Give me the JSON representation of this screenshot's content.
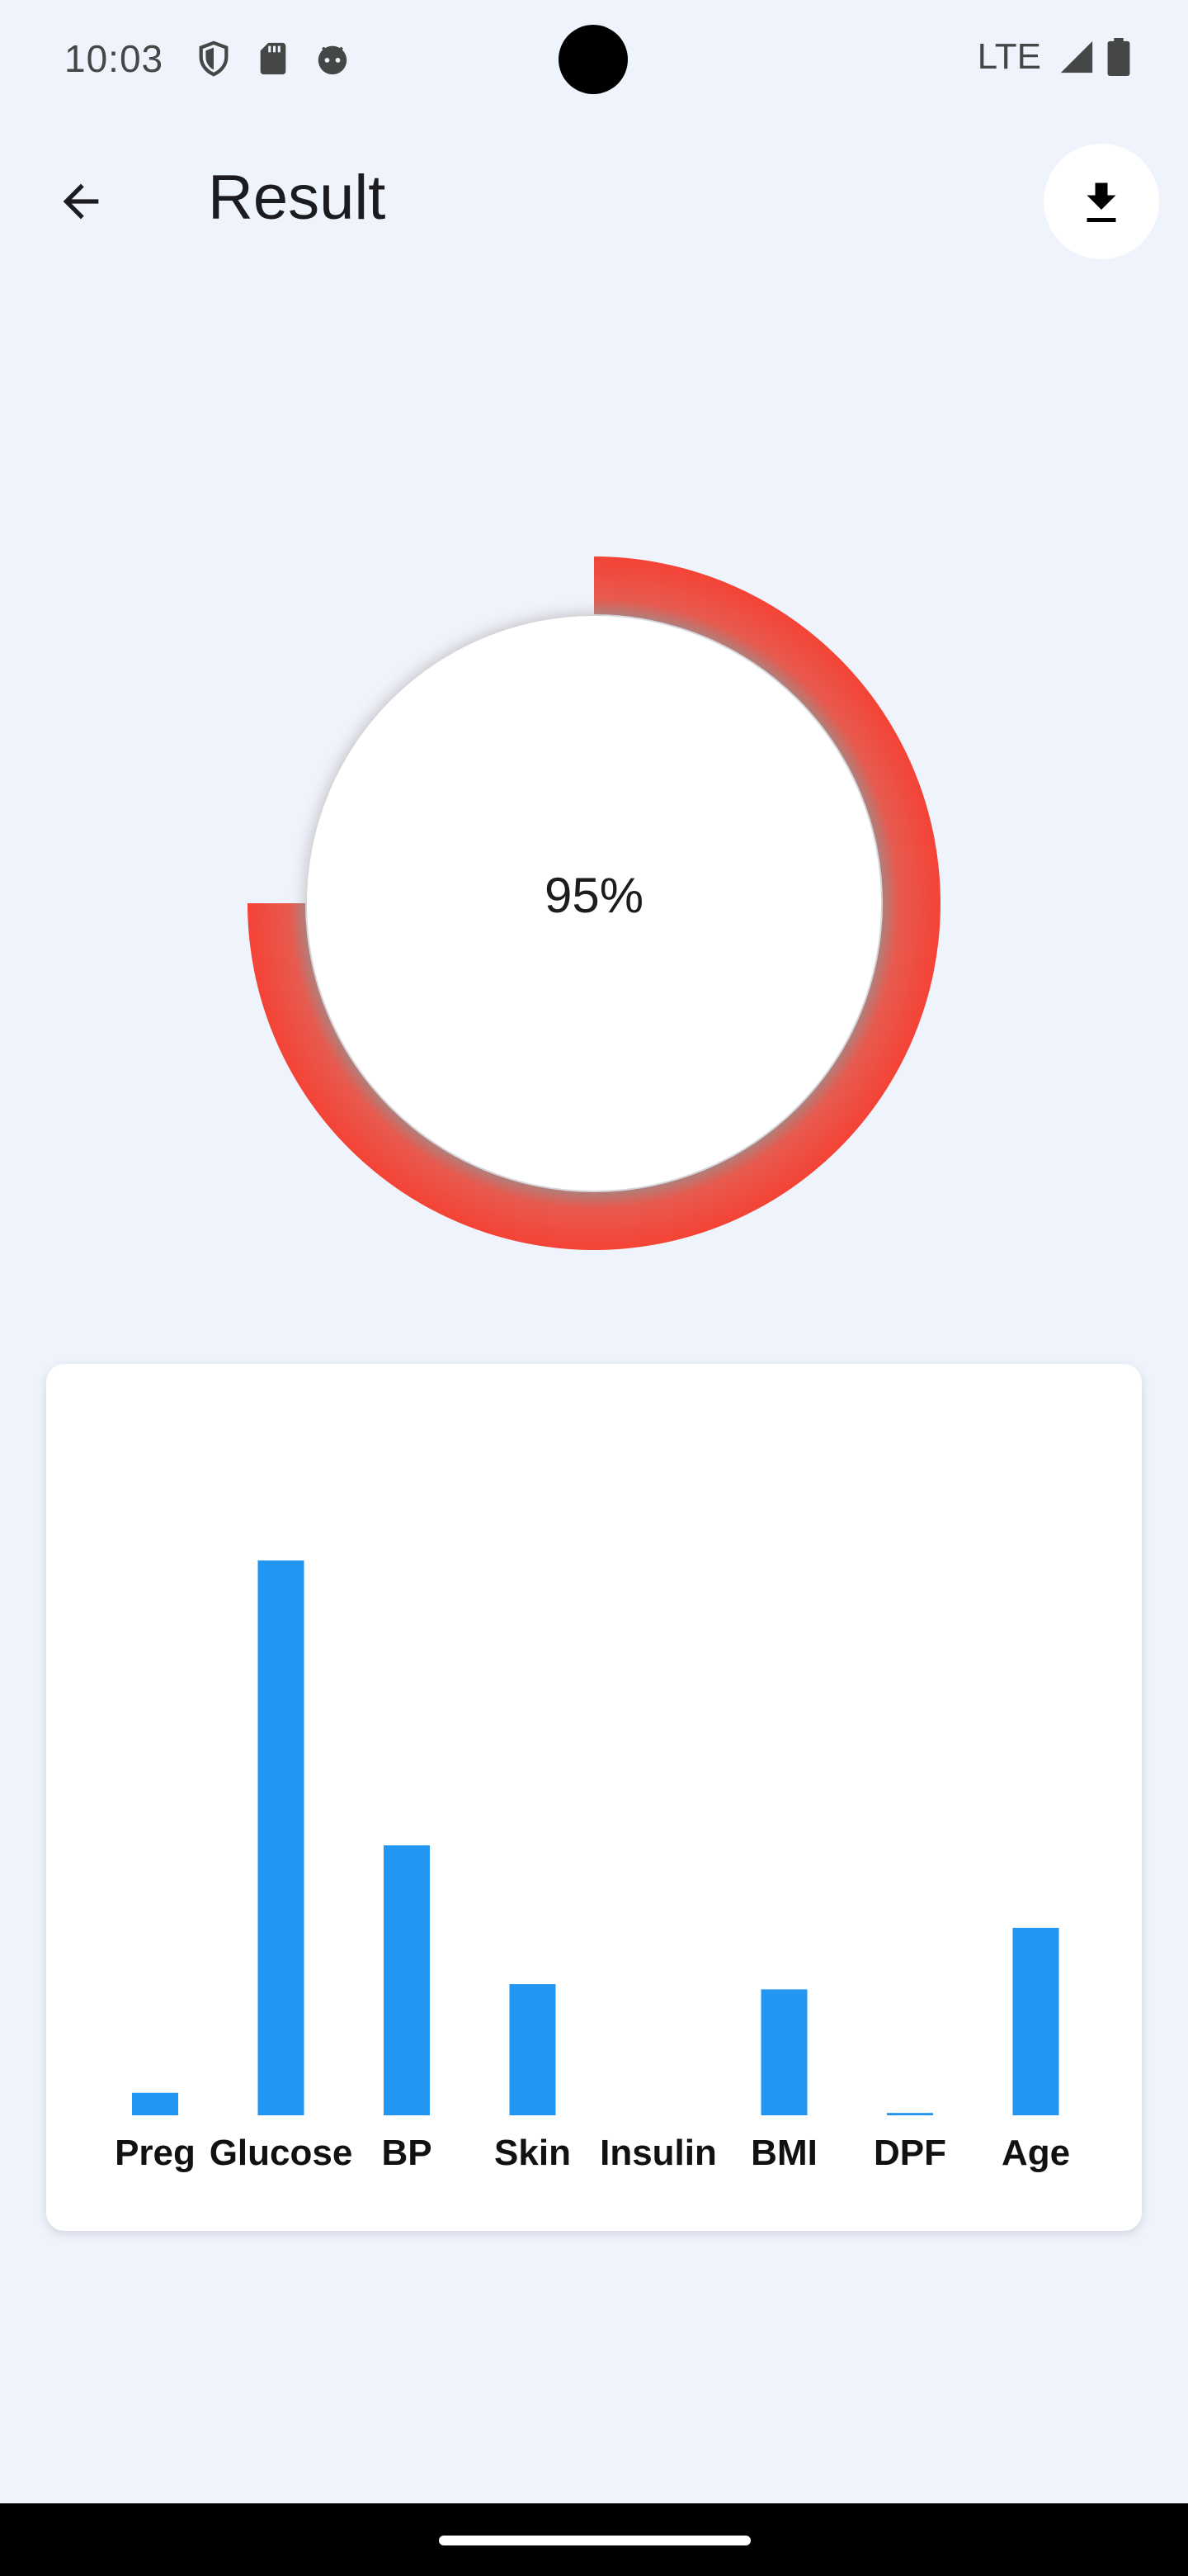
{
  "status_bar": {
    "time": "10:03",
    "network": "LTE",
    "icons": [
      "shield-icon",
      "sd-card-icon",
      "android-face-icon",
      "signal-icon",
      "battery-icon"
    ]
  },
  "app_bar": {
    "title": "Result",
    "back_icon": "arrow-back-icon",
    "download_icon": "download-icon"
  },
  "gauge": {
    "value_text": "95%",
    "progress": 0.75,
    "ring_color": "#f44336",
    "center_color": "#ffffff"
  },
  "chart_data": {
    "type": "bar",
    "categories": [
      "Preg",
      "Glucose",
      "BP",
      "Skin",
      "Insulin",
      "BMI",
      "DPF",
      "Age"
    ],
    "values": [
      6,
      148,
      72,
      35,
      0,
      33.6,
      0.627,
      50
    ],
    "ylim": [
      0,
      148
    ],
    "bar_color": "#2196f3",
    "grid": false,
    "legend": "none"
  },
  "colors": {
    "background": "#eff3fc",
    "card": "#ffffff",
    "accent": "#2196f3",
    "risk": "#f44336"
  }
}
